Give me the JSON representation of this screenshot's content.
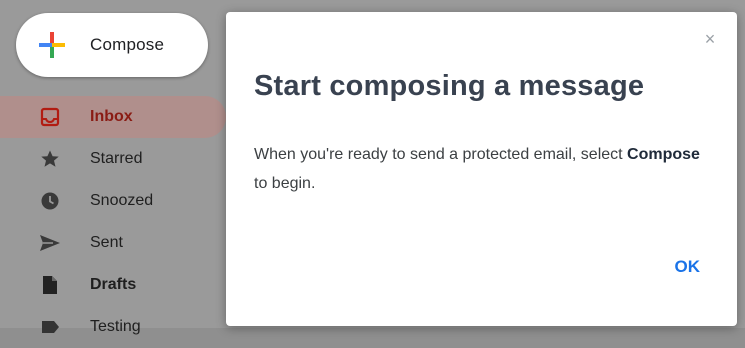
{
  "compose": {
    "label": "Compose"
  },
  "sidebar": {
    "items": [
      {
        "label": "Inbox",
        "icon": "inbox-icon"
      },
      {
        "label": "Starred",
        "icon": "star-icon"
      },
      {
        "label": "Snoozed",
        "icon": "clock-icon"
      },
      {
        "label": "Sent",
        "icon": "send-icon"
      },
      {
        "label": "Drafts",
        "icon": "draft-icon"
      },
      {
        "label": "Testing",
        "icon": "label-icon"
      }
    ]
  },
  "dialog": {
    "close": "×",
    "title": "Start composing a message",
    "body_before": "When you're ready to send a protected email, select ",
    "body_emphasis": "Compose",
    "body_after": " to begin.",
    "ok_label": "OK"
  },
  "colors": {
    "accent": "#1a73e8",
    "inbox_active": "#8a1c14",
    "title": "#394250"
  }
}
